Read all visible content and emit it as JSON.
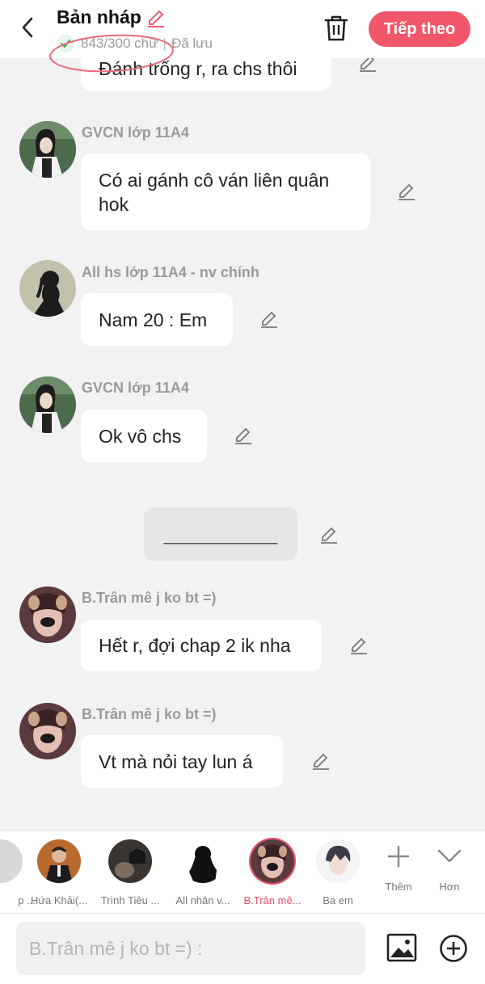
{
  "header": {
    "title": "Bản nháp",
    "word_count": "843/300 chữ",
    "separator": "|",
    "save_status": "Đã lưu",
    "next_label": "Tiếp theo",
    "accent_color": "#f1566b"
  },
  "messages": [
    {
      "text": "Đánh trống r, ra chs thôi"
    },
    {
      "name": "GVCN lớp 11A4",
      "text": "Có ai gánh cô ván liên quân hok"
    },
    {
      "name": "All hs lớp 11A4 - nv chính",
      "text": "Nam 20 : Em"
    },
    {
      "name": "GVCN lớp 11A4",
      "text": "Ok vô chs"
    },
    {
      "text": "___________"
    },
    {
      "name": "B.Trân mê j ko bt =)",
      "text": "Hết r, đợi chap 2 ik nha"
    },
    {
      "name": "B.Trân mê j ko bt =)",
      "text": "Vt mà nỏi tay lun á"
    }
  ],
  "characters": [
    {
      "name": "p ..."
    },
    {
      "name": "Hứa Khải(..."
    },
    {
      "name": "Trình Tiêu ..."
    },
    {
      "name": "All nhân v..."
    },
    {
      "name": "B.Trân mê..."
    },
    {
      "name": "Ba em"
    }
  ],
  "tools": {
    "more_label": "Thêm",
    "expand_label": "Hơn"
  },
  "input": {
    "placeholder": "B.Trân mê j ko bt =) :"
  }
}
